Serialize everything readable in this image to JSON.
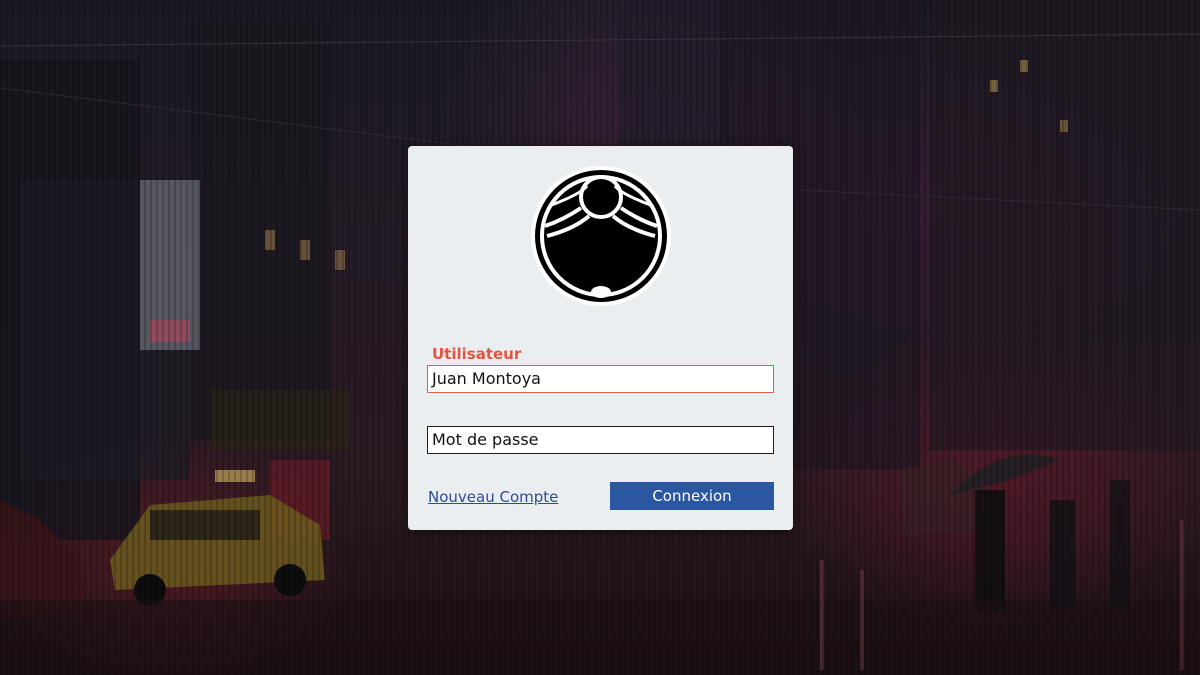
{
  "login": {
    "username_label": "Utilisateur",
    "username_value": "Juan Montoya",
    "password_placeholder": "Mot de passe",
    "new_account_link": "Nouveau Compte",
    "submit_label": "Connexion"
  },
  "logo": {
    "icon": "circular-emblem-icon"
  },
  "background": {
    "description_icon": "rainy-city-street-icon"
  },
  "colors": {
    "card_background": "#ebeef0",
    "label_accent": "#e4543f",
    "button": "#2b57a0",
    "link": "#2a4f8f"
  }
}
